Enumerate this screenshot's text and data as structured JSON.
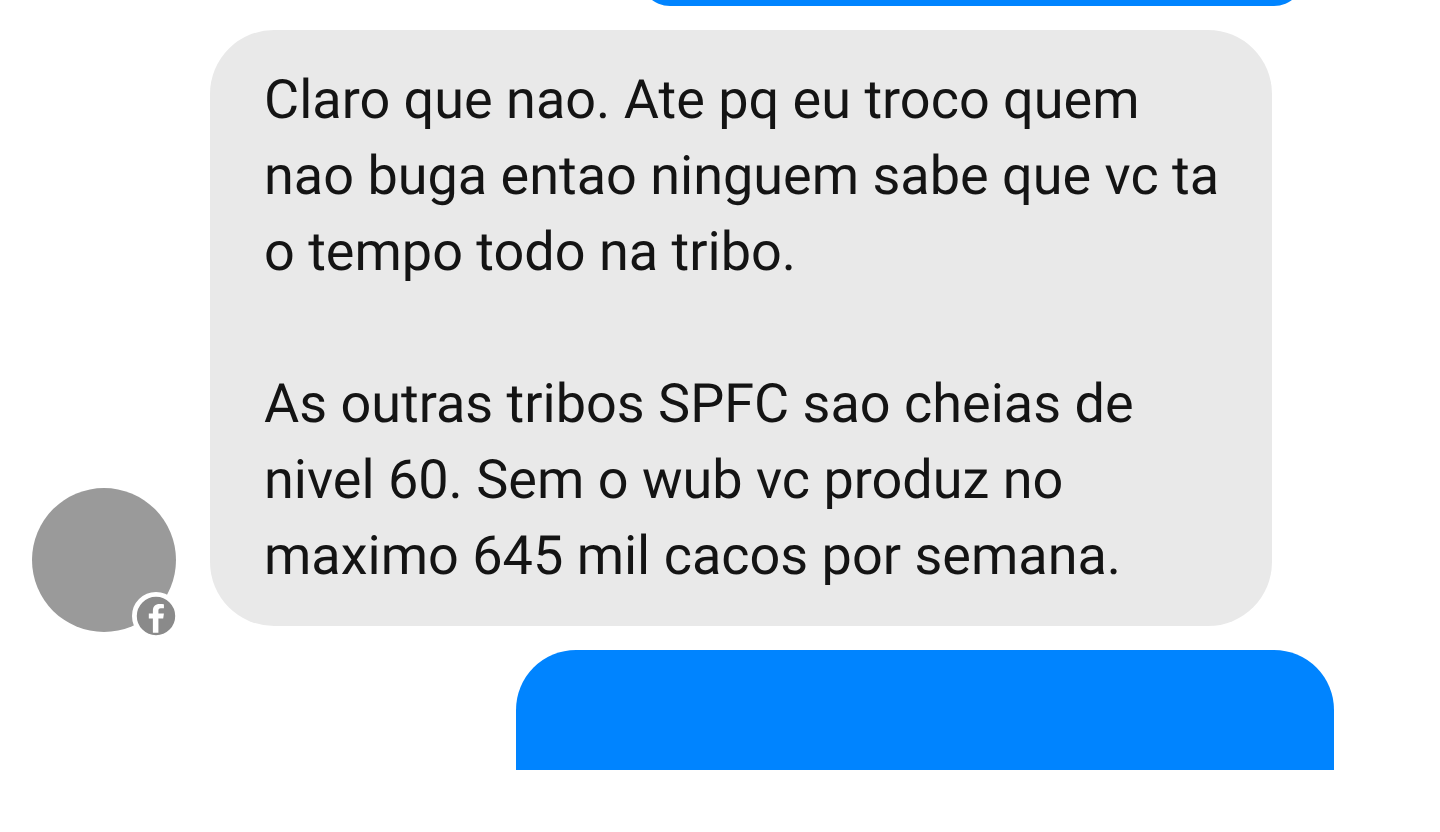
{
  "messages": [
    {
      "kind": "outgoing"
    },
    {
      "kind": "incoming",
      "paragraphs": [
        "Claro que nao. Ate pq eu troco quem nao buga entao ninguem sabe que vc ta o tempo todo na tribo.",
        "As outras tribos SPFC sao cheias de nivel 60. Sem o wub vc produz no maximo 645 mil cacos por semana."
      ]
    },
    {
      "kind": "outgoing"
    }
  ]
}
